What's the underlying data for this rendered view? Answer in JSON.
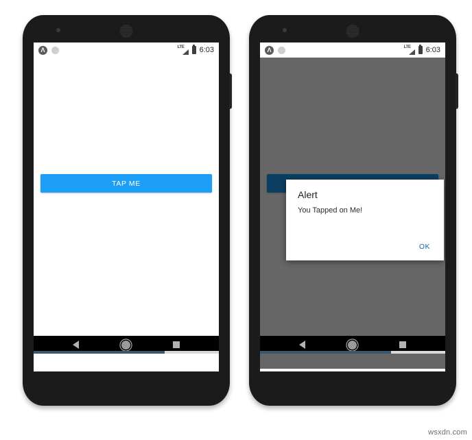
{
  "watermark": "wsxdn.com",
  "status_bar": {
    "app_icon": "Ⓐ",
    "app_icon_glyph": "Λ",
    "notification_dot": "circle-icon",
    "network_label": "LTE",
    "battery": "battery-icon",
    "time": "6:03"
  },
  "nav_bar": {
    "back": "back-triangle-icon",
    "home": "home-circle-icon",
    "recents": "recents-square-icon"
  },
  "phones": [
    {
      "name": "phone-before-tap",
      "screen_state": "idle",
      "button_label": "TAP ME",
      "dialog_visible": false
    },
    {
      "name": "phone-after-tap",
      "screen_state": "dialog-open",
      "button_label": "TAP ME",
      "dialog_visible": true
    }
  ],
  "dialog": {
    "title": "Alert",
    "message": "You Tapped on Me!",
    "ok_label": "OK"
  },
  "colors": {
    "button_blue": "#1b9ef3",
    "ok_blue": "#1668a3",
    "scrim": "#666666",
    "phone_body": "#1b1b1b",
    "nav_bar": "#000000",
    "scroll_thumb": "#3c566b"
  }
}
